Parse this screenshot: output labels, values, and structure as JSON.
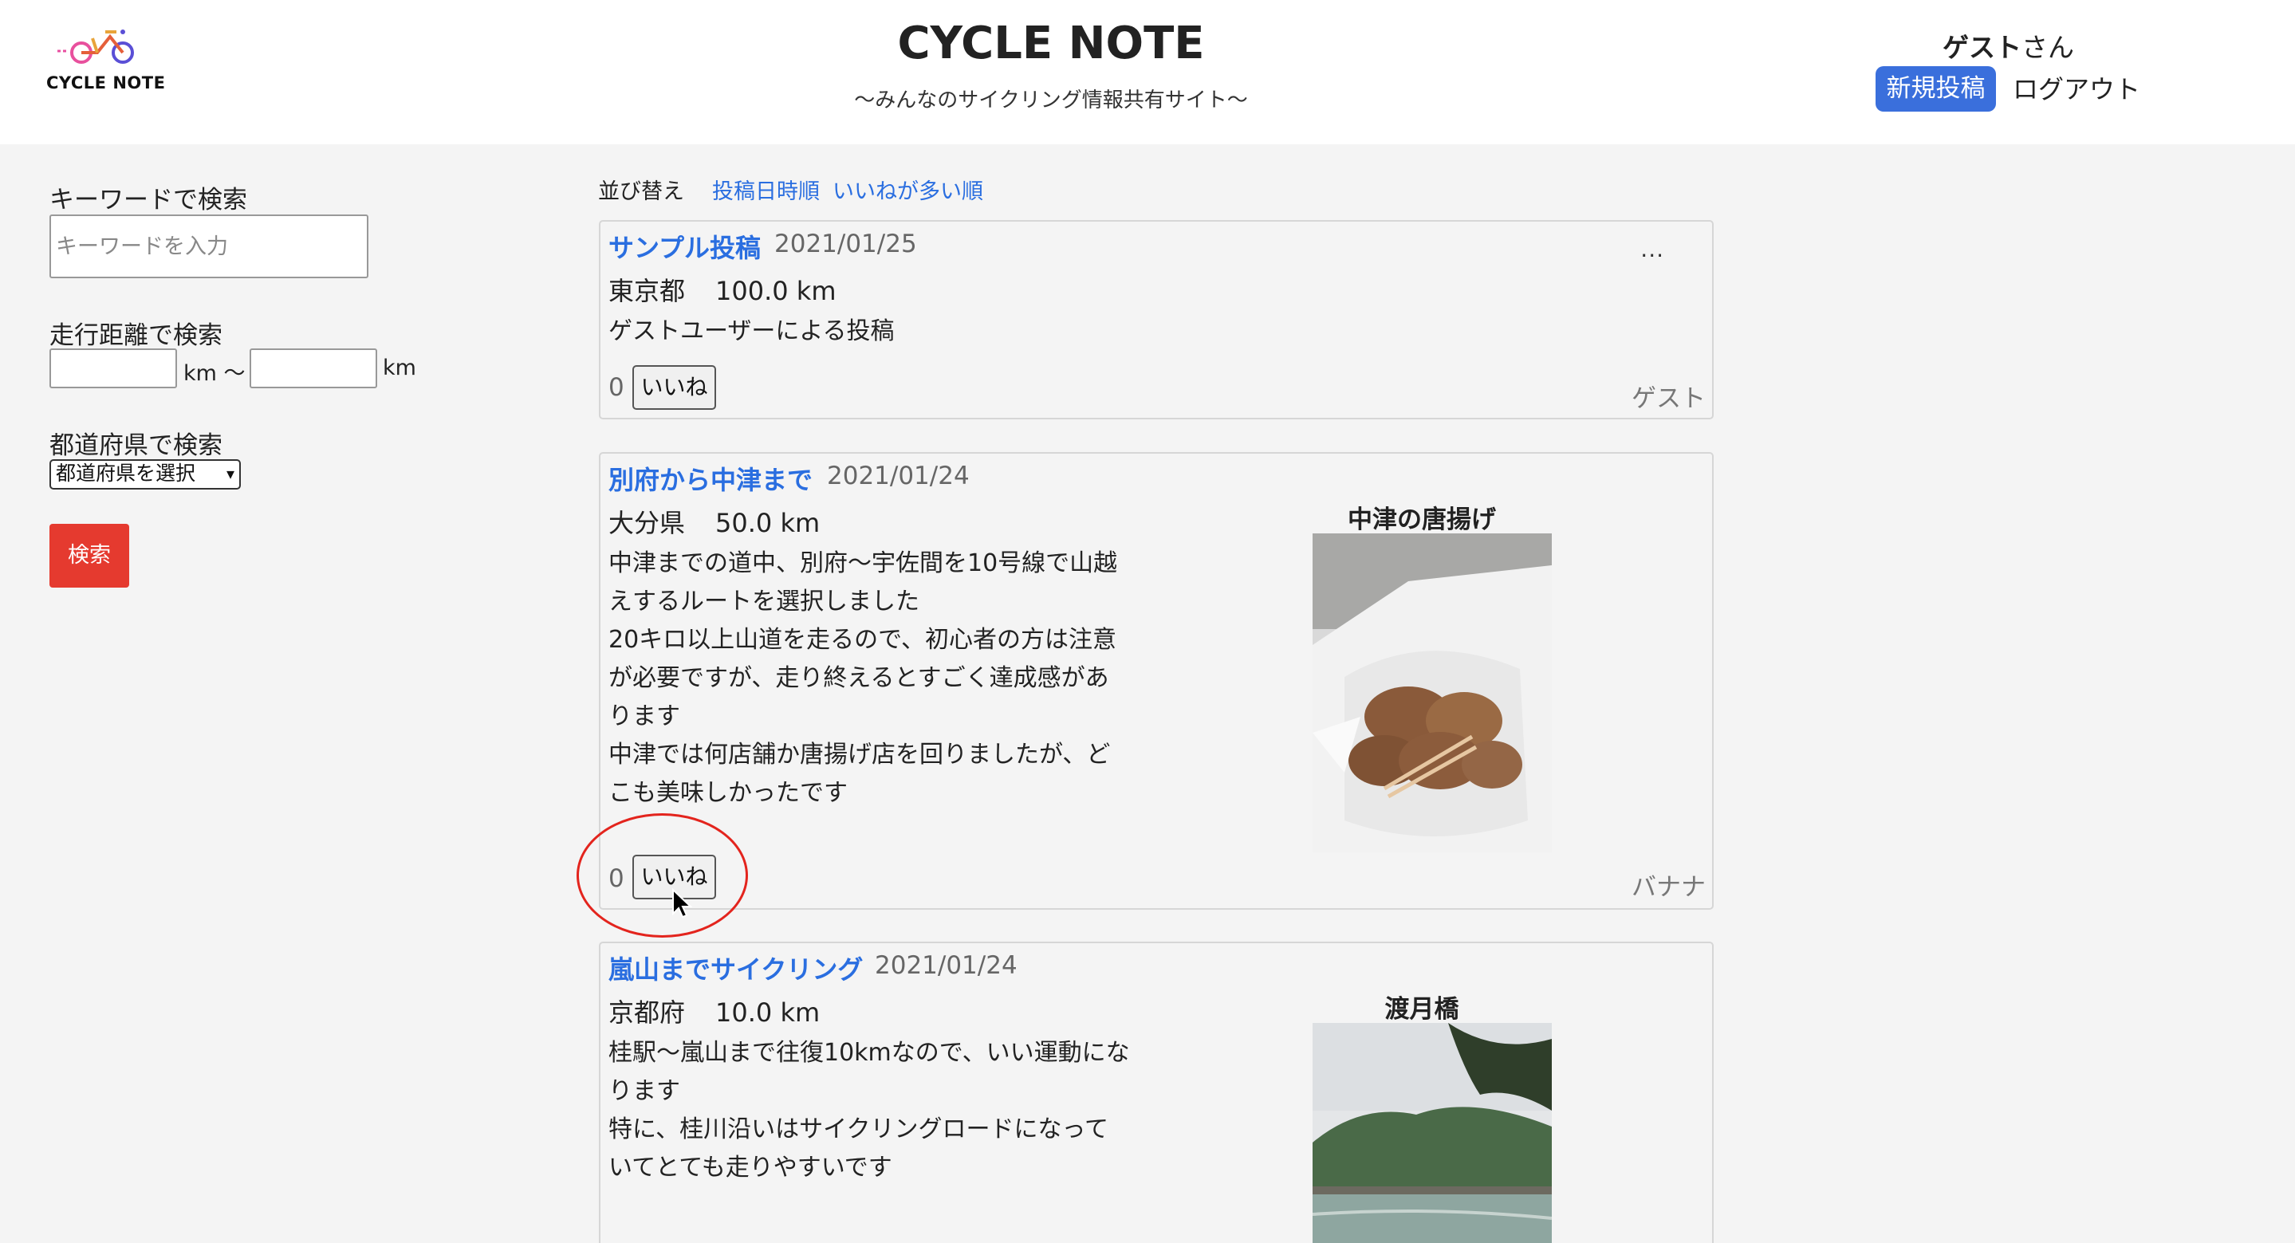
{
  "header": {
    "logo_text": "CYCLE NOTE",
    "site_title": "CYCLE NOTE",
    "site_subtitle": "〜みんなのサイクリング情報共有サイト〜",
    "user_name": "ゲスト",
    "user_suffix": "さん",
    "new_post_label": "新規投稿",
    "logout_label": "ログアウト"
  },
  "sidebar": {
    "keyword_label": "キーワードで検索",
    "keyword_placeholder": "キーワードを入力",
    "distance_label": "走行距離で検索",
    "km_unit_1": "km 〜",
    "km_unit_2": "km",
    "prefecture_label": "都道府県で検索",
    "prefecture_selected": "都道府県を選択",
    "search_button": "検索"
  },
  "sort": {
    "label": "並び替え",
    "by_date": "投稿日時順",
    "by_likes": "いいねが多い順"
  },
  "posts": [
    {
      "title": "サンプル投稿",
      "date": "2021/01/25",
      "prefecture": "東京都",
      "distance": "100.0  km",
      "body": [
        "ゲストユーザーによる投稿"
      ],
      "likes": "0",
      "like_label": "いいね",
      "author": "ゲスト",
      "menu": "..."
    },
    {
      "title": "別府から中津まで",
      "date": "2021/01/24",
      "prefecture": "大分県",
      "distance": "50.0  km",
      "body": [
        "中津までの道中、別府〜宇佐間を10号線で山越",
        "えするルートを選択しました",
        "20キロ以上山道を走るので、初心者の方は注意",
        "が必要ですが、走り終えるとすごく達成感があ",
        "ります",
        "中津では何店舗か唐揚げ店を回りましたが、ど",
        "こも美味しかったです"
      ],
      "photo_caption": "中津の唐揚げ",
      "likes": "0",
      "like_label": "いいね",
      "author": "バナナ"
    },
    {
      "title": "嵐山までサイクリング",
      "date": "2021/01/24",
      "prefecture": "京都府",
      "distance": "10.0  km",
      "body": [
        "桂駅〜嵐山まで往復10kmなので、いい運動にな",
        "ります",
        "特に、桂川沿いはサイクリングロードになって",
        "いてとても走りやすいです"
      ],
      "photo_caption": "渡月橋"
    }
  ],
  "colors": {
    "accent_blue": "#2a6ee0",
    "new_post_bg": "#3a6fdc",
    "search_red": "#e53a2f",
    "highlight_circle": "#e3241d"
  }
}
